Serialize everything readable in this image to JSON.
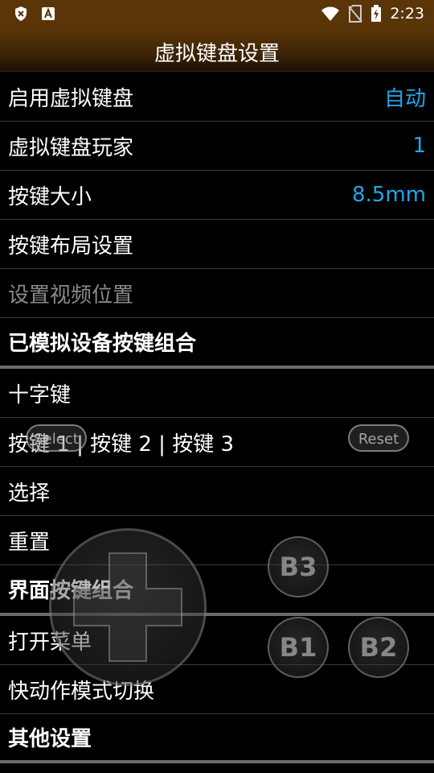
{
  "statusbar": {
    "time": "2:23",
    "left_icons": [
      "shield-icon",
      "font-a-icon"
    ],
    "right_icons": [
      "wifi-icon",
      "no-sim-icon",
      "battery-charging-icon"
    ]
  },
  "header": {
    "title": "虚拟键盘设置"
  },
  "list": [
    {
      "label": "启用虚拟键盘",
      "value": "自动",
      "style": "normal"
    },
    {
      "label": "虚拟键盘玩家",
      "value": "1",
      "style": "normal"
    },
    {
      "label": "按键大小",
      "value": "8.5mm",
      "style": "normal"
    },
    {
      "label": "按键布局设置",
      "value": "",
      "style": "normal"
    },
    {
      "label": "设置视频位置",
      "value": "",
      "style": "disabled"
    },
    {
      "label": "已模拟设备按键组合",
      "value": "",
      "style": "header"
    },
    {
      "label": "十字键",
      "value": "",
      "style": "normal"
    },
    {
      "label": "按键 1 | 按键 2 | 按键 3",
      "value": "",
      "style": "normal"
    },
    {
      "label": "选择",
      "value": "",
      "style": "normal"
    },
    {
      "label": "重置",
      "value": "",
      "style": "normal"
    },
    {
      "label": "界面按键组合",
      "value": "",
      "style": "header"
    },
    {
      "label": "打开菜单",
      "value": "",
      "style": "normal"
    },
    {
      "label": "快动作模式切换",
      "value": "",
      "style": "normal"
    },
    {
      "label": "其他设置",
      "value": "",
      "style": "header"
    }
  ],
  "overlay": {
    "select_label": "Select",
    "reset_label": "Reset",
    "b1_label": "B1",
    "b2_label": "B2",
    "b3_label": "B3"
  },
  "colors": {
    "accent": "#1ea7e8",
    "titlebar": "#5a3508"
  }
}
